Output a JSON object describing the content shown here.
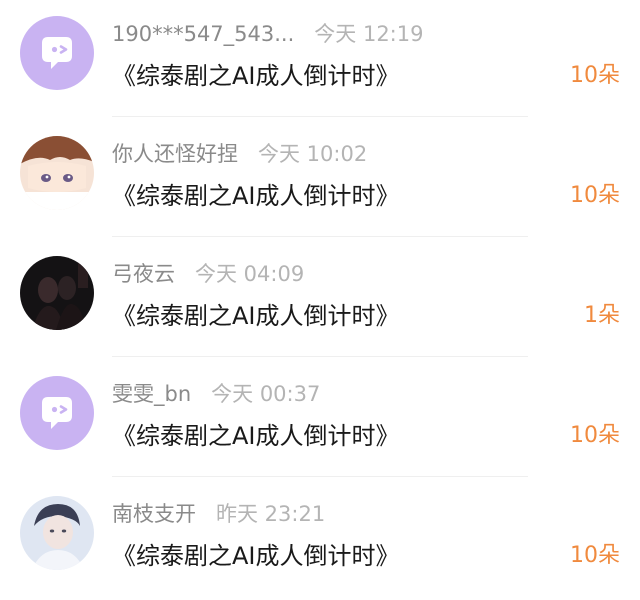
{
  "list": {
    "items": [
      {
        "username": "190***547_543...",
        "time": "今天 12:19",
        "title": "《综泰剧之AI成人倒计时》",
        "count": "10朵",
        "avatar": "default-chat-bubble-avatar"
      },
      {
        "username": "你人还怪好捏",
        "time": "今天 10:02",
        "title": "《综泰剧之AI成人倒计时》",
        "count": "10朵",
        "avatar": "anime-boy-avatar"
      },
      {
        "username": "弓夜云",
        "time": "今天 04:09",
        "title": "《综泰剧之AI成人倒计时》",
        "count": "1朵",
        "avatar": "dark-photo-avatar"
      },
      {
        "username": "雯雯_bn",
        "time": "今天 00:37",
        "title": "《综泰剧之AI成人倒计时》",
        "count": "10朵",
        "avatar": "default-chat-bubble-avatar"
      },
      {
        "username": "南枝支开",
        "time": "昨天 23:21",
        "title": "《综泰剧之AI成人倒计时》",
        "count": "10朵",
        "avatar": "portrait-avatar"
      }
    ]
  },
  "colors": {
    "accent_count": "#f08a3e",
    "default_avatar_bg": "#c9b3f2",
    "username": "#8a8a8a",
    "time": "#b4b4b4",
    "title": "#1a1a1a"
  }
}
